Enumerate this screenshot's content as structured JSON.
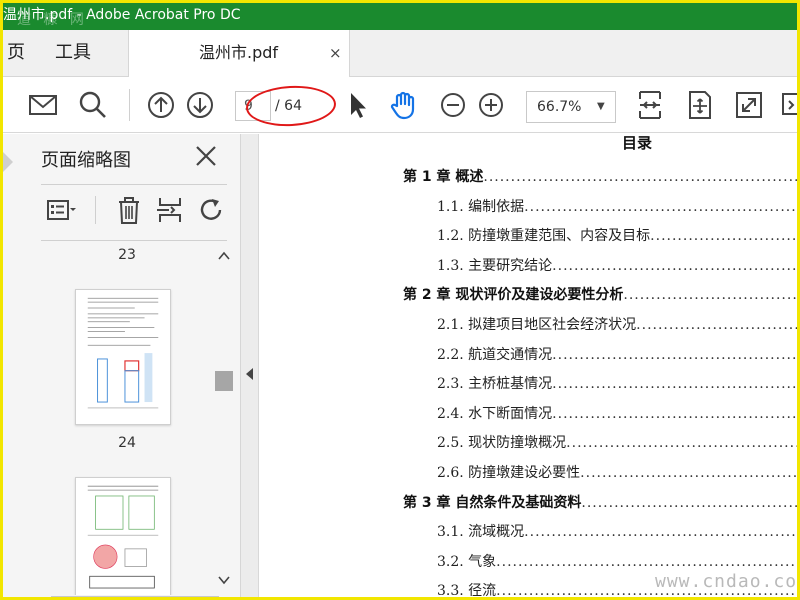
{
  "window": {
    "title": "温州市.pdf - Adobe Acrobat Pro DC",
    "watermark_top": "道 糠 网"
  },
  "tabs": {
    "home": "页",
    "tools": "工具",
    "document": "温州市.pdf",
    "close": "×"
  },
  "toolbar": {
    "page_current": "9",
    "page_total": "/ 64",
    "zoom": "66.7%",
    "zoom_dropdown": "▼"
  },
  "sidebar": {
    "title": "页面缩略图",
    "pages": [
      "23",
      "24"
    ]
  },
  "document": {
    "toc_title": "目录",
    "entries": [
      {
        "text": "第 1 章  概述",
        "dots": "......................................................................",
        "level": "chapter"
      },
      {
        "text": "1.1.  编制依据",
        "dots": "......................................................................",
        "level": "section"
      },
      {
        "text": "1.2.  防撞墩重建范围、内容及目标",
        "dots": "..........................................",
        "level": "section"
      },
      {
        "text": "1.3.  主要研究结论",
        "dots": "......................................................................",
        "level": "section"
      },
      {
        "text": "第 2 章  现状评价及建设必要性分析",
        "dots": ".....................................................",
        "level": "chapter"
      },
      {
        "text": "2.1.  拟建项目地区社会经济状况",
        "dots": ".......................................................",
        "level": "section"
      },
      {
        "text": "2.2.  航道交通情况",
        "dots": "......................................................................",
        "level": "section"
      },
      {
        "text": "2.3.  主桥桩基情况",
        "dots": "......................................................................",
        "level": "section"
      },
      {
        "text": "2.4.  水下断面情况",
        "dots": "......................................................................",
        "level": "section"
      },
      {
        "text": "2.5.  现状防撞墩概况",
        "dots": "......................................................................",
        "level": "section"
      },
      {
        "text": "2.6.  防撞墩建设必要性",
        "dots": "......................................................................",
        "level": "section"
      },
      {
        "text": "第 3 章  自然条件及基础资料",
        "dots": "......................................................................",
        "level": "chapter"
      },
      {
        "text": "3.1.  流域概况",
        "dots": "......................................................................",
        "level": "section"
      },
      {
        "text": "3.2.  气象",
        "dots": "......................................................................",
        "level": "section"
      },
      {
        "text": "3.3.  径流",
        "dots": "......................................................................",
        "level": "section"
      }
    ]
  },
  "footer_watermark": "www.cndao.com"
}
